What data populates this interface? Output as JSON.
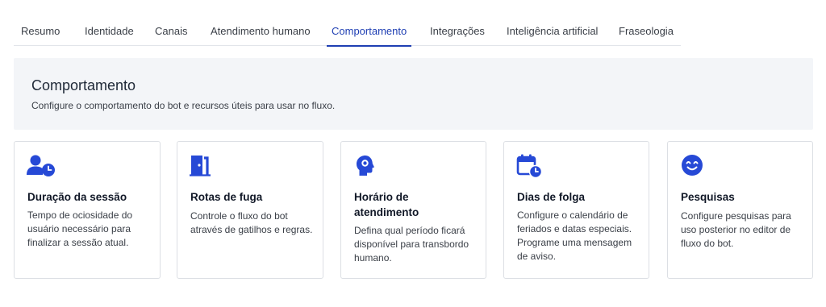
{
  "tabs": [
    {
      "label": "Resumo"
    },
    {
      "label": "Identidade"
    },
    {
      "label": "Canais"
    },
    {
      "label": "Atendimento humano"
    },
    {
      "label": "Comportamento",
      "active": true
    },
    {
      "label": "Integrações"
    },
    {
      "label": "Inteligência artificial"
    },
    {
      "label": "Fraseologia"
    }
  ],
  "header": {
    "title": "Comportamento",
    "subtitle": "Configure o comportamento do bot e recursos úteis para usar no fluxo."
  },
  "cards": [
    {
      "icon": "user-clock-icon",
      "title": "Duração da sessão",
      "description": "Tempo de ociosidade do usuário necessário para finalizar a sessão atual."
    },
    {
      "icon": "exit-door-icon",
      "title": "Rotas de fuga",
      "description": "Controle o fluxo do bot através de gatilhos e regras."
    },
    {
      "icon": "head-gear-icon",
      "title": "Horário de atendimento",
      "description": "Defina qual período ficará disponível para transbordo humano."
    },
    {
      "icon": "calendar-clock-icon",
      "title": "Dias de folga",
      "description": "Configure o calendário de feriados e datas especiais. Programe uma mensagem de aviso."
    },
    {
      "icon": "smiley-icon",
      "title": "Pesquisas",
      "description": "Configure pesquisas para uso posterior no editor de fluxo do bot."
    }
  ],
  "colors": {
    "accent": "#1f3fb3",
    "icon": "#2649d6",
    "panel": "#f3f5f8"
  }
}
